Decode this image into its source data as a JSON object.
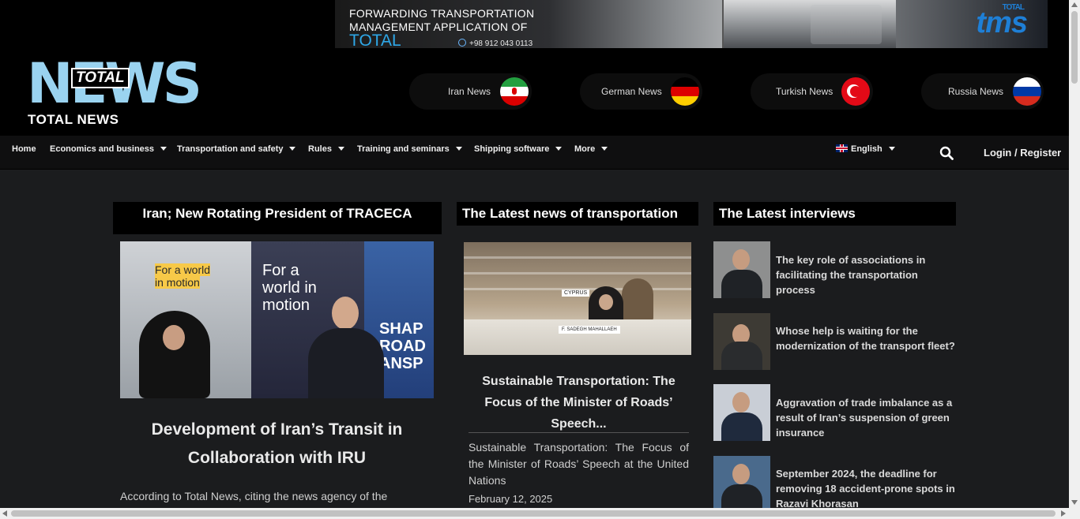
{
  "banner": {
    "line1": "FORWARDING TRANSPORTATION",
    "line2": "MANAGEMENT APPLICATION OF",
    "brand": "TOTAL",
    "phone": "+98 912 043 0113",
    "logo_small": "TOTAL",
    "logo_main": "tms"
  },
  "logo": {
    "main": "NEWS",
    "badge": "TOTAL",
    "subtitle": "TOTAL NEWS"
  },
  "countries": [
    {
      "label": "Iran News",
      "flag": "iran-flag-icon"
    },
    {
      "label": "German News",
      "flag": "germany-flag-icon"
    },
    {
      "label": "Turkish News",
      "flag": "turkey-flag-icon"
    },
    {
      "label": "Russia News",
      "flag": "russia-flag-icon"
    }
  ],
  "nav": {
    "items": [
      {
        "label": "Home"
      },
      {
        "label": "Economics and business"
      },
      {
        "label": "Transportation and safety"
      },
      {
        "label": "Rules"
      },
      {
        "label": "Training and seminars"
      },
      {
        "label": "Shipping software"
      },
      {
        "label": "More"
      }
    ],
    "language": "English",
    "login": "Login / Register"
  },
  "columns": {
    "left": {
      "title": "Iran; New Rotating President of TRACECA",
      "image_text_1a": "For a world",
      "image_text_1b": "in motion",
      "image_text_2a": "For a",
      "image_text_2b": "world in",
      "image_text_2c": "motion",
      "image_text_3": "SHAP ROAD ANSP",
      "headline": "Development of Iran’s Transit in Collaboration with IRU",
      "excerpt": "According to Total News, citing the news agency of the"
    },
    "middle": {
      "title": "The Latest news of transportation",
      "image_label": "F. SADEGH MAHALLAEH",
      "image_label_2": "CYPRUS",
      "headline": "Sustainable Transportation: The Focus of the Minister of Roads’ Speech...",
      "excerpt": "Sustainable Transportation: The Focus of the Minister of Roads’ Speech at the United Nations",
      "date": "February 12, 2025"
    },
    "right": {
      "title": "The Latest interviews",
      "items": [
        {
          "title": "The key role of associations in facilitating the transportation process"
        },
        {
          "title": "Whose help is waiting for the modernization of the transport fleet?"
        },
        {
          "title": "Aggravation of trade imbalance as a result of Iran’s suspension of green insurance"
        },
        {
          "title": "September 2024, the deadline for removing 18 accident-prone spots in Razavi Khorasan"
        }
      ]
    }
  },
  "colors": {
    "background": "#1b1c1e",
    "header": "#000000",
    "nav": "#0f0f10",
    "accent_blue": "#2ea8e8"
  }
}
